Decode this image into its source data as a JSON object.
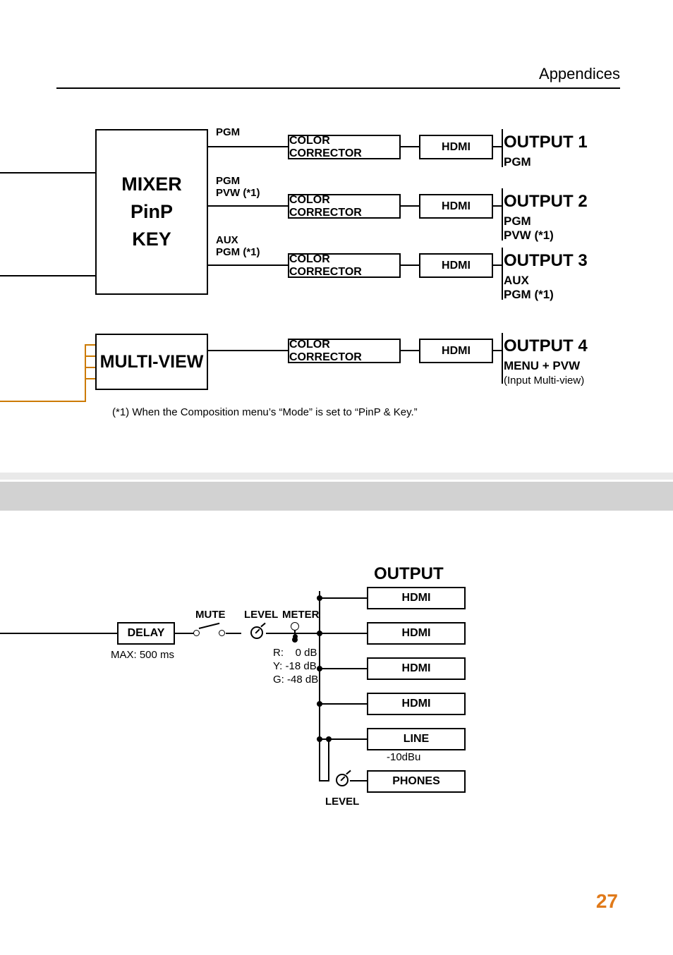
{
  "header": {
    "section": "Appendices"
  },
  "diagram1": {
    "mixer": {
      "line1": "MIXER",
      "line2": "PinP",
      "line3": "KEY"
    },
    "multiview": "MULTI-VIEW",
    "signals": {
      "s1": "PGM",
      "s2": "PGM\nPVW (*1)",
      "s3": "AUX\nPGM (*1)"
    },
    "cc_label": "COLOR CORRECTOR",
    "hdmi_label": "HDMI",
    "outputs": {
      "o1": {
        "title": "OUTPUT 1",
        "sub": "PGM"
      },
      "o2": {
        "title": "OUTPUT 2",
        "sub": "PGM\nPVW (*1)"
      },
      "o3": {
        "title": "OUTPUT 3",
        "sub": "AUX\nPGM (*1)"
      },
      "o4": {
        "title": "OUTPUT 4",
        "sub_bold": "MENU + PVW",
        "sub_note": "(Input Multi-view)"
      }
    },
    "footnote": "(*1) When the Composition menu’s “Mode” is set to “PinP & Key.”"
  },
  "diagram2": {
    "output_title": "OUTPUT",
    "delay": {
      "label": "DELAY",
      "max": "MAX: 500 ms"
    },
    "mute": "MUTE",
    "level": "LEVEL",
    "meter": {
      "label": "METER",
      "r": "R:    0 dB",
      "y": "Y: -18 dB",
      "g": "G: -48 dB"
    },
    "phones_level": "LEVEL",
    "outputs": {
      "hdmi": "HDMI",
      "line": "LINE",
      "line_sub": "-10dBu",
      "phones": "PHONES"
    }
  },
  "page_number": "27"
}
